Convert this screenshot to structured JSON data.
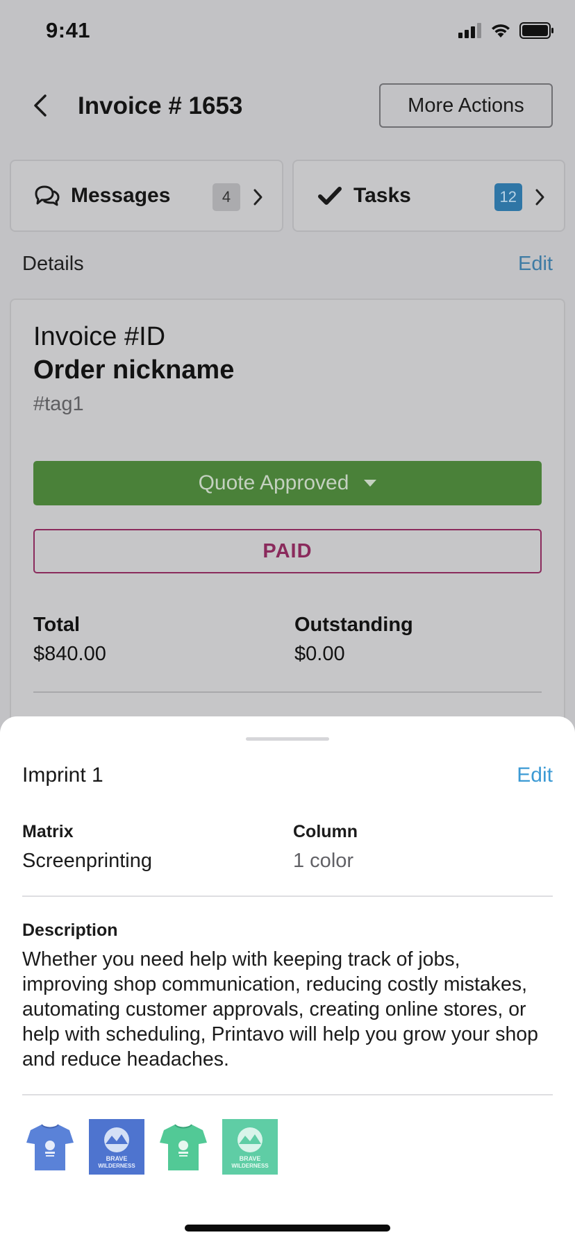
{
  "status_bar": {
    "time": "9:41"
  },
  "nav": {
    "title": "Invoice # 1653",
    "more_actions_label": "More Actions"
  },
  "tabs": {
    "messages": {
      "label": "Messages",
      "count": "4"
    },
    "tasks": {
      "label": "Tasks",
      "count": "12"
    }
  },
  "details": {
    "label": "Details",
    "edit_label": "Edit"
  },
  "invoice": {
    "id_line": "Invoice #ID",
    "nickname": "Order nickname",
    "tag": "#tag1",
    "status_label": "Quote Approved",
    "paid_label": "PAID",
    "total_label": "Total",
    "total_value": "$840.00",
    "outstanding_label": "Outstanding",
    "outstanding_value": "$0.00"
  },
  "sheet": {
    "title": "Imprint 1",
    "edit_label": "Edit",
    "matrix_label": "Matrix",
    "matrix_value": "Screenprinting",
    "column_label": "Column",
    "column_value": "1 color",
    "description_label": "Description",
    "description_text": "Whether you need help with keeping track of jobs, improving shop communication, reducing costly mistakes, automating customer approvals, creating online stores, or help with scheduling, Printavo will help you grow your shop and reduce headaches.",
    "thumbnails": [
      {
        "kind": "tshirt",
        "color": "#5a82d8",
        "icon": "tshirt-blue-icon"
      },
      {
        "kind": "artwork",
        "color": "#4e74cf",
        "icon": "artwork-blue-icon",
        "text_line1": "BRAVE",
        "text_line2": "WILDERNESS"
      },
      {
        "kind": "tshirt",
        "color": "#52c996",
        "icon": "tshirt-green-icon"
      },
      {
        "kind": "artwork",
        "color": "#5fcda5",
        "icon": "artwork-green-icon",
        "text_line1": "BRAVE",
        "text_line2": "WILDERNESS"
      }
    ]
  },
  "colors": {
    "accent_blue": "#3c9ad4",
    "status_green": "#4a8139",
    "paid_magenta": "#8a2a5c"
  }
}
